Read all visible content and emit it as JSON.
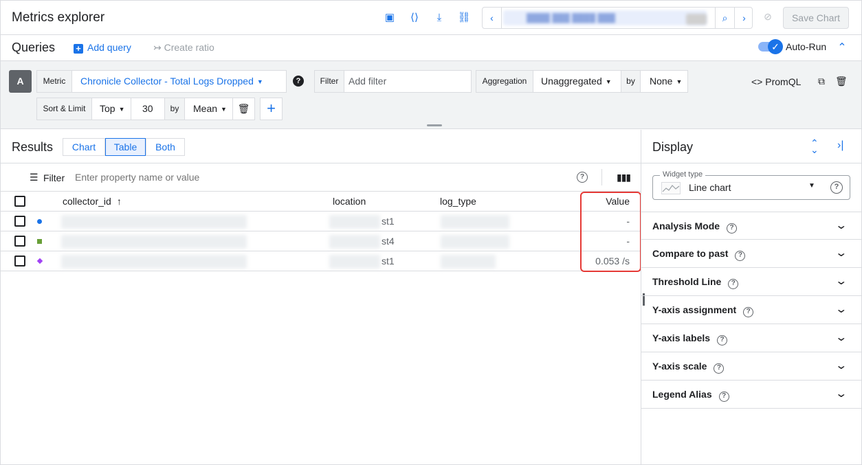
{
  "app": {
    "title": "Metrics explorer",
    "save_chart_label": "Save Chart"
  },
  "queries": {
    "title": "Queries",
    "add_query_label": "Add query",
    "create_ratio_label": "Create ratio",
    "auto_run_label": "Auto-Run",
    "query_letter": "A",
    "metric_label": "Metric",
    "metric_value": "Chronicle Collector - Total Logs Dropped",
    "filter_label": "Filter",
    "filter_placeholder": "Add filter",
    "aggregation_label": "Aggregation",
    "aggregation_value": "Unaggregated",
    "by_label": "by",
    "by_value": "None",
    "promql_label": "PromQL",
    "sort_limit_label": "Sort & Limit",
    "sort_value": "Top",
    "limit_value": "30",
    "sort_by_label": "by",
    "sort_by_value": "Mean"
  },
  "results": {
    "title": "Results",
    "view_tabs": [
      "Chart",
      "Table",
      "Both"
    ],
    "active_tab": "Table",
    "filter_label": "Filter",
    "filter_placeholder": "Enter property name or value",
    "columns": [
      "collector_id",
      "location",
      "log_type",
      "Value"
    ],
    "rows": [
      {
        "marker": "dot",
        "color": "#1a73e8",
        "location_suffix": "st1",
        "value": "-"
      },
      {
        "marker": "square",
        "color": "#689f38",
        "location_suffix": "st4",
        "value": "-"
      },
      {
        "marker": "diamond",
        "color": "#a142f4",
        "location_suffix": "st1",
        "value": "0.053  /s"
      }
    ]
  },
  "display": {
    "title": "Display",
    "widget_type_label": "Widget type",
    "widget_type_value": "Line chart",
    "sections": [
      "Analysis Mode",
      "Compare to past",
      "Threshold Line",
      "Y-axis assignment",
      "Y-axis labels",
      "Y-axis scale",
      "Legend Alias"
    ]
  },
  "colors": {
    "accent": "#1a73e8",
    "highlight_box": "#e53935"
  }
}
